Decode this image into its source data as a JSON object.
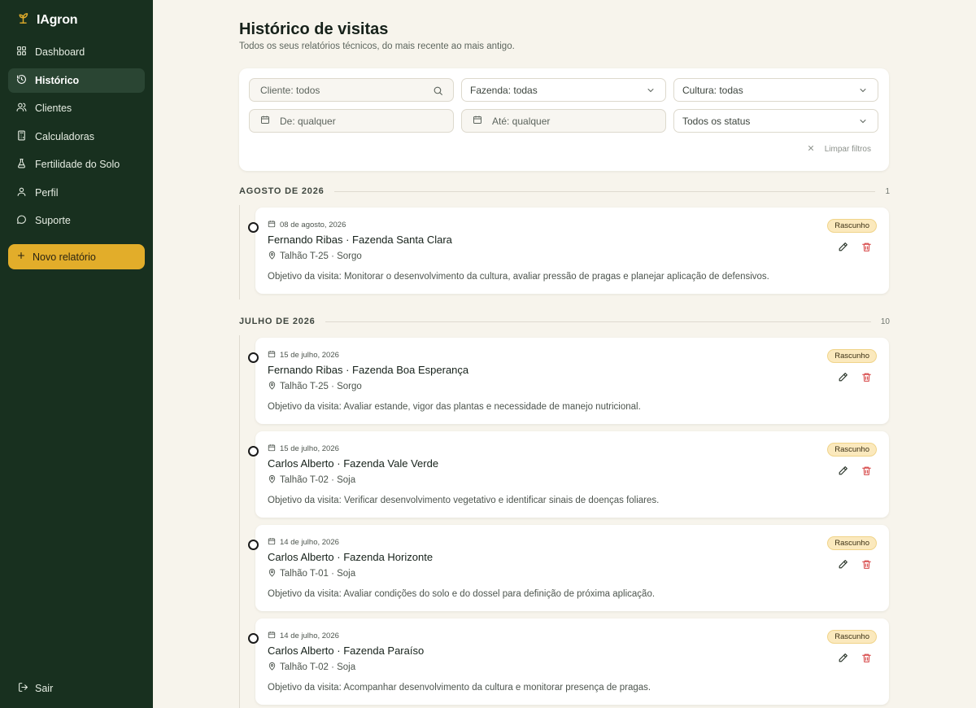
{
  "app": {
    "name": "IAgron"
  },
  "sidebar": {
    "items": [
      {
        "label": "Dashboard",
        "icon": "grid-icon"
      },
      {
        "label": "Histórico",
        "icon": "history-icon"
      },
      {
        "label": "Clientes",
        "icon": "users-icon"
      },
      {
        "label": "Calculadoras",
        "icon": "calculator-icon"
      },
      {
        "label": "Fertilidade do Solo",
        "icon": "flask-icon"
      },
      {
        "label": "Perfil",
        "icon": "user-icon"
      },
      {
        "label": "Suporte",
        "icon": "chat-icon"
      }
    ],
    "active_index": 1,
    "new_report_label": "Novo relatório",
    "logout_label": "Sair"
  },
  "page": {
    "title": "Histórico de visitas",
    "subtitle": "Todos os seus relatórios técnicos, do mais recente ao mais antigo."
  },
  "filters": {
    "client_placeholder": "Cliente: todos",
    "farm_value": "Fazenda: todas",
    "crop_value": "Cultura: todas",
    "from_placeholder": "De: qualquer",
    "to_placeholder": "Até: qualquer",
    "status_value": "Todos os status",
    "clear_label": "Limpar filtros"
  },
  "groups": [
    {
      "label": "AGOSTO DE 2026",
      "count": "1",
      "visits": [
        {
          "date": "08 de agosto, 2026",
          "title": "Fernando Ribas · Fazenda Santa Clara",
          "plot": "Talhão T-25 · Sorgo",
          "objective": "Objetivo da visita: Monitorar o desenvolvimento da cultura, avaliar pressão de pragas e planejar aplicação de defensivos.",
          "status": "Rascunho"
        }
      ]
    },
    {
      "label": "JULHO DE 2026",
      "count": "10",
      "visits": [
        {
          "date": "15 de julho, 2026",
          "title": "Fernando Ribas · Fazenda Boa Esperança",
          "plot": "Talhão T-25 · Sorgo",
          "objective": "Objetivo da visita: Avaliar estande, vigor das plantas e necessidade de manejo nutricional.",
          "status": "Rascunho"
        },
        {
          "date": "15 de julho, 2026",
          "title": "Carlos Alberto · Fazenda Vale Verde",
          "plot": "Talhão T-02 · Soja",
          "objective": "Objetivo da visita: Verificar desenvolvimento vegetativo e identificar sinais de doenças foliares.",
          "status": "Rascunho"
        },
        {
          "date": "14 de julho, 2026",
          "title": "Carlos Alberto · Fazenda Horizonte",
          "plot": "Talhão T-01 · Soja",
          "objective": "Objetivo da visita: Avaliar condições do solo e do dossel para definição de próxima aplicação.",
          "status": "Rascunho"
        },
        {
          "date": "14 de julho, 2026",
          "title": "Carlos Alberto · Fazenda Paraíso",
          "plot": "Talhão T-02 · Soja",
          "objective": "Objetivo da visita: Acompanhar desenvolvimento da cultura e monitorar presença de pragas.",
          "status": "Rascunho"
        }
      ]
    }
  ],
  "colors": {
    "sidebar_bg": "#18301f",
    "sidebar_active": "#2a4533",
    "accent": "#e2ad2a",
    "page_bg": "#f7f4ec",
    "badge_bg": "#fbe9bd",
    "delete": "#d64545"
  }
}
